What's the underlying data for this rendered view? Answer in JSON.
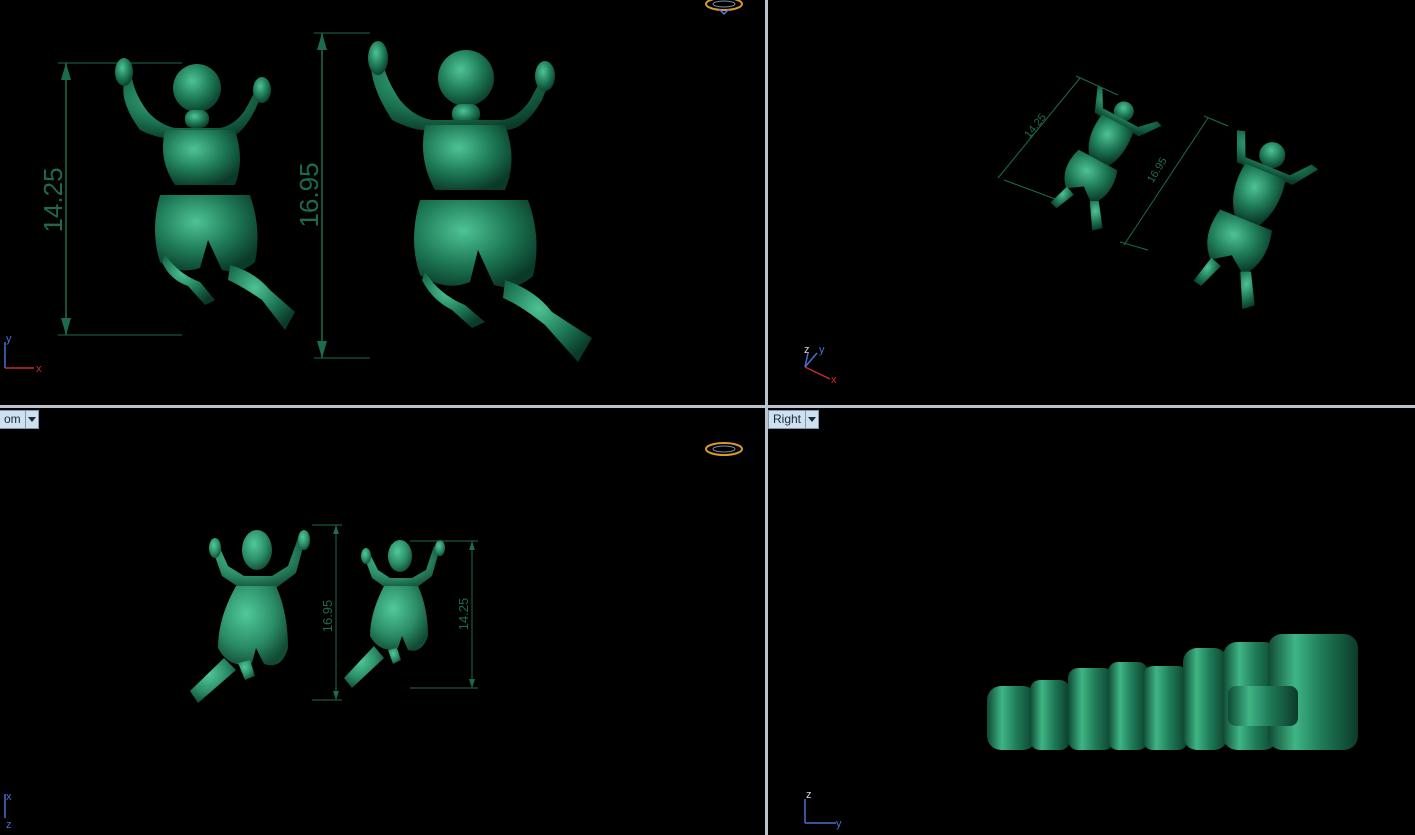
{
  "viewports": {
    "top_left": {
      "dimensions": [
        "14.25",
        "16.95"
      ],
      "axes": {
        "x": "x",
        "y": "y"
      }
    },
    "top_right": {
      "dimensions": [
        "14.25",
        "16.95"
      ],
      "axes": {
        "x": "x",
        "y": "y",
        "z": "z"
      }
    },
    "bottom_left": {
      "tab_label": "om",
      "dimensions": [
        "16.95",
        "14.25"
      ],
      "axes": {
        "x": "x",
        "z": "z"
      }
    },
    "bottom_right": {
      "tab_label": "Right",
      "axes": {
        "y": "y",
        "z": "z"
      }
    }
  },
  "colors": {
    "background": "#000000",
    "model_green": "#1e7a57",
    "dimension_green": "#1d6b4d",
    "axis_x": "#cc2a2a",
    "axis_y": "#4a6fd0",
    "axis_z": "#4a6fd0",
    "divider": "#b9c4cc"
  },
  "icons": {
    "nav_widget": "view-navigation-ring-icon"
  }
}
